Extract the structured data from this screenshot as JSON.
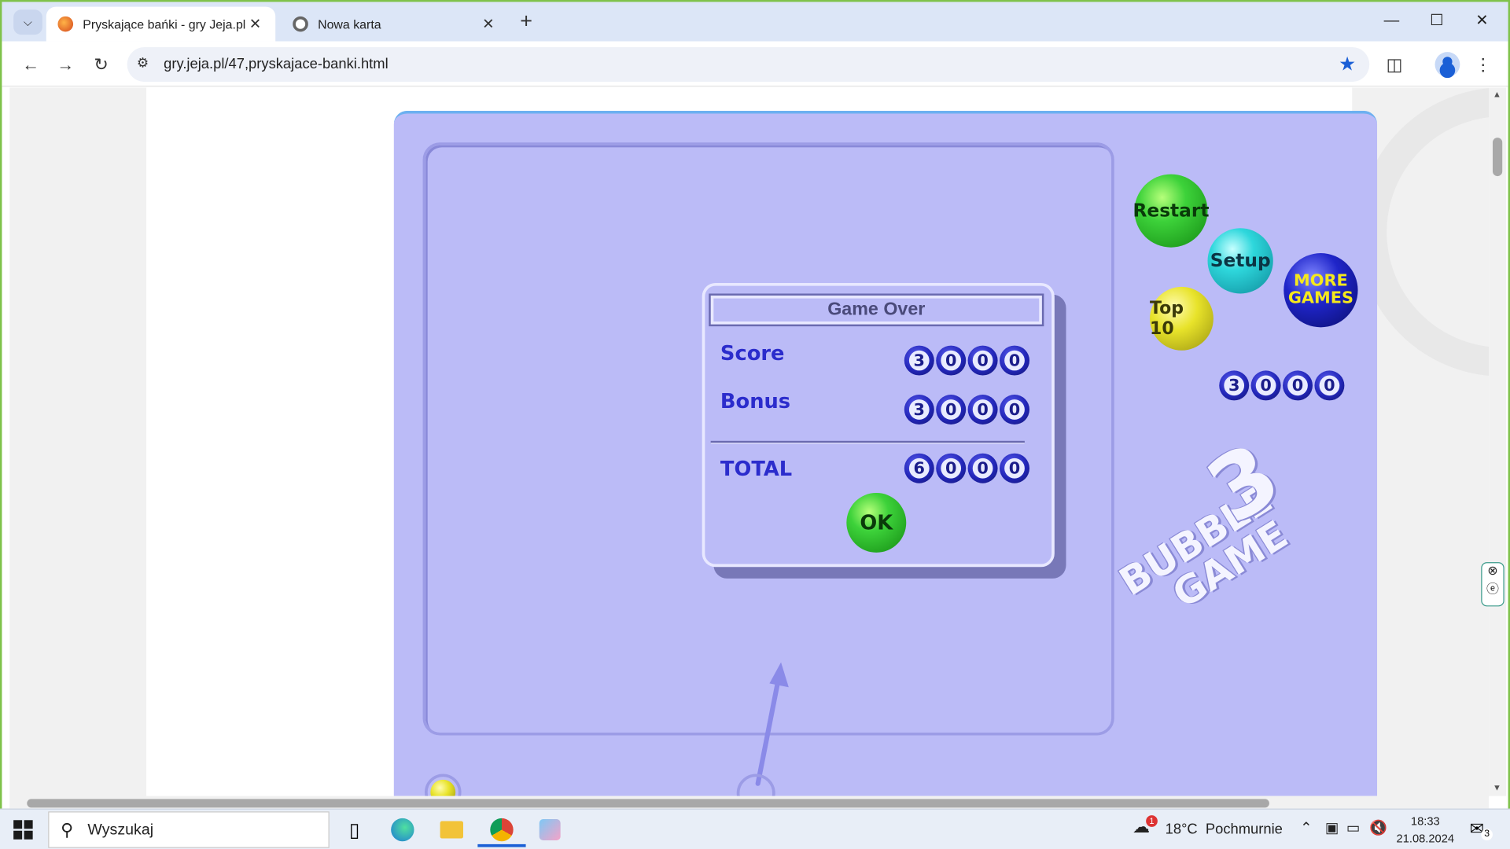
{
  "browser": {
    "tabs": [
      {
        "title": "Pryskające bańki - gry Jeja.pl",
        "active": true
      },
      {
        "title": "Nowa karta",
        "active": false
      }
    ],
    "url": "gry.jeja.pl/47,pryskajace-banki.html"
  },
  "game": {
    "buttons": {
      "restart": "Restart",
      "setup": "Setup",
      "top10": "Top 10",
      "more_games_line1": "MORE",
      "more_games_line2": "GAMES"
    },
    "current_score_digits": [
      "3",
      "0",
      "0",
      "0"
    ],
    "dialog": {
      "title": "Game Over",
      "score_label": "Score",
      "score_digits": [
        "3",
        "0",
        "0",
        "0"
      ],
      "bonus_label": "Bonus",
      "bonus_digits": [
        "3",
        "0",
        "0",
        "0"
      ],
      "total_label": "TOTAL",
      "total_digits": [
        "6",
        "0",
        "0",
        "0"
      ],
      "ok_label": "OK"
    },
    "logo": {
      "line1": "BUBBLE",
      "line2": "GAME",
      "number": "3"
    }
  },
  "taskbar": {
    "search_placeholder": "Wyszukaj",
    "weather": "18°C  Pochmurnie",
    "weather_badge": "1",
    "time": "18:33",
    "date": "21.08.2024",
    "notifications": "3"
  }
}
